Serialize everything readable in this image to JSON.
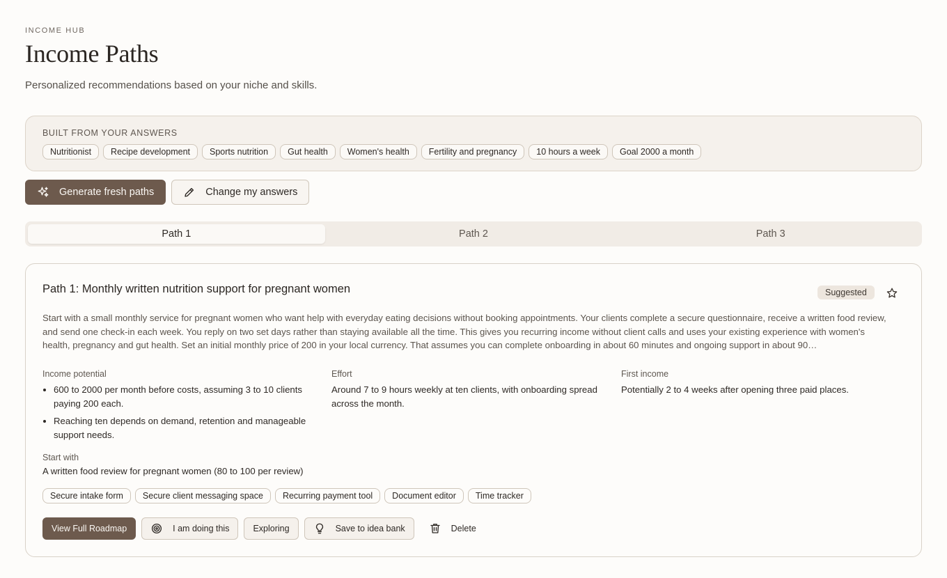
{
  "header": {
    "eyebrow": "INCOME HUB",
    "title": "Income Paths",
    "subtitle": "Personalized recommendations based on your niche and skills."
  },
  "answers": {
    "label": "BUILT FROM YOUR ANSWERS",
    "chips": [
      "Nutritionist",
      "Recipe development",
      "Sports nutrition",
      "Gut health",
      "Women's health",
      "Fertility and pregnancy",
      "10 hours a week",
      "Goal 2000 a month"
    ]
  },
  "actions": {
    "generate_label": "Generate fresh paths",
    "change_label": "Change my answers"
  },
  "tabs": [
    "Path 1",
    "Path 2",
    "Path 3"
  ],
  "active_tab": "Path 1",
  "path": {
    "title": "Path 1: Monthly written nutrition support for pregnant women",
    "badge": "Suggested",
    "description": "Start with a small monthly service for pregnant women who want help with everyday eating decisions without booking appointments. Your clients complete a secure questionnaire, receive a written food review, and send one check-in each week. You reply on two set days rather than staying available all the time. This gives you recurring income without client calls and uses your existing experience with women's health, pregnancy and gut health. Set an initial monthly price of 200 in your local currency. That assumes you can complete onboarding in about 60 minutes and ongoing support in about 90…",
    "income_label": "Income potential",
    "income_points": [
      "600 to 2000 per month before costs, assuming 3 to 10 clients paying 200 each.",
      "Reaching ten depends on demand, retention and manageable support needs."
    ],
    "effort_label": "Effort",
    "effort_text": "Around 7 to 9 hours weekly at ten clients, with onboarding spread across the month.",
    "first_income_label": "First income",
    "first_income_text": "Potentially 2 to 4 weeks after opening three paid places.",
    "start_label": "Start with",
    "start_text": "A written food review for pregnant women (80 to 100 per review)",
    "tools": [
      "Secure intake form",
      "Secure client messaging space",
      "Recurring payment tool",
      "Document editor",
      "Time tracker"
    ],
    "buttons": {
      "roadmap": "View Full Roadmap",
      "doing": "I am doing this",
      "exploring": "Exploring",
      "save": "Save to idea bank",
      "delete": "Delete"
    }
  },
  "colors": {
    "accent": "#6d5a4d",
    "background": "#fdfcfa",
    "panel": "#f5f1ec"
  }
}
